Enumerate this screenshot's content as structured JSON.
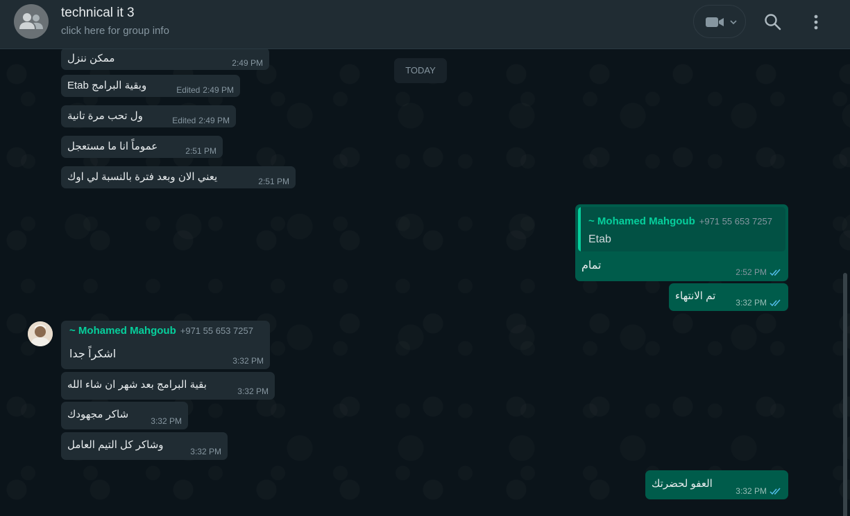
{
  "header": {
    "title": "technical it 3",
    "subtitle": "click here for group info"
  },
  "colors": {
    "background": "#0b141a",
    "header": "#202c33",
    "incoming_bubble": "#202c33",
    "outgoing_bubble": "#005c4b",
    "sender_accent": "#06cf9c",
    "read_ticks": "#53bdeb"
  },
  "icons": {
    "group_avatar": "group-icon",
    "video": "video-camera-icon",
    "dropdown": "chevron-down-icon",
    "search": "search-icon",
    "menu": "kebab-menu-icon",
    "read_receipt": "double-check-icon"
  },
  "date_separator": "TODAY",
  "messages_top": [
    {
      "text": "ممكن ننزل",
      "time": "2:49 PM",
      "edited": ""
    },
    {
      "text": "وبقية البرامج Etab",
      "time": "2:49 PM",
      "edited": "Edited"
    },
    {
      "text": "ول تحب مرة تانية",
      "time": "2:49 PM",
      "edited": "Edited"
    },
    {
      "text": "عموماً انا ما مستعجل",
      "time": "2:51 PM",
      "edited": ""
    },
    {
      "text": "يعني الان وبعد فترة بالنسبة لي اوك",
      "time": "2:51 PM",
      "edited": ""
    }
  ],
  "reply_message": {
    "quoted_sender": "~ Mohamed Mahgoub",
    "quoted_phone": "+971 55 653 7257",
    "quoted_text": "Etab",
    "text": "تمام",
    "time": "2:52 PM"
  },
  "outgoing_1": {
    "text": "تم الانتهاء",
    "time": "3:32 PM"
  },
  "group_messages": {
    "sender": "~ Mohamed Mahgoub",
    "phone": "+971 55 653 7257",
    "first": {
      "text": "اشكراً جدا",
      "time": "3:32 PM"
    },
    "rest": [
      {
        "text": "بقية البرامج بعد شهر ان شاء الله",
        "time": "3:32 PM"
      },
      {
        "text": "شاكر مجهودك",
        "time": "3:32 PM"
      },
      {
        "text": "وشاكر كل التيم العامل",
        "time": "3:32 PM"
      }
    ]
  },
  "outgoing_2": {
    "text": "العفو لحضرتك",
    "time": "3:32 PM"
  }
}
